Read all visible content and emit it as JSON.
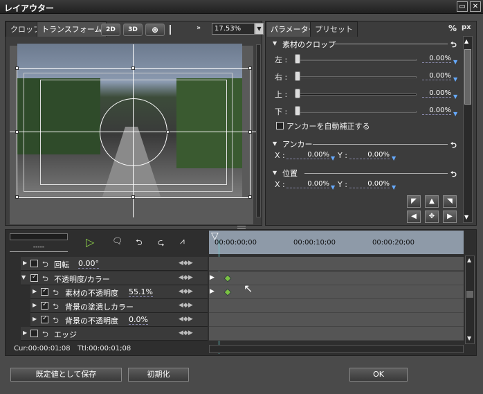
{
  "window": {
    "title": "レイアウター",
    "min_icon": "minimize-icon",
    "close_icon": "close-icon"
  },
  "left_tabs": {
    "crop": "クロップ",
    "transform": "トランスフォーム"
  },
  "toolbar": {
    "btn_2d": "2D",
    "btn_3d": "3D",
    "zoom": "17.53%"
  },
  "right_tabs": {
    "params": "パラメーター",
    "presets": "プリセット",
    "percent": "%",
    "px": "px"
  },
  "crop": {
    "section": "素材のクロップ",
    "left": "左 :",
    "right": "右 :",
    "top": "上 :",
    "bottom": "下 :",
    "left_val": "0.00%",
    "right_val": "0.00%",
    "top_val": "0.00%",
    "bottom_val": "0.00%",
    "auto_correct": "アンカーを自動補正する"
  },
  "anchor": {
    "section": "アンカー",
    "x_label": "X :",
    "y_label": "Y :",
    "x_val": "0.00%",
    "y_val": "0.00%"
  },
  "position": {
    "section": "位置",
    "x_label": "X :",
    "y_label": "Y :",
    "x_val": "0.00%",
    "y_val": "0.00%"
  },
  "timeline": {
    "ticks": [
      "00:00:00;00",
      "00:00:10;00",
      "00:00:20;00"
    ],
    "rotate": {
      "label": "回転",
      "value": "0.00°"
    },
    "opacity_color": {
      "label": "不透明度/カラー"
    },
    "clip_opacity": {
      "label": "素材の不透明度",
      "value": "55.1%"
    },
    "bg_fill": {
      "label": "背景の塗潰しカラー"
    },
    "bg_opacity": {
      "label": "背景の不透明度",
      "value": "0.0%"
    },
    "edge": {
      "label": "エッジ"
    },
    "cur": "Cur:00:00:01;08",
    "ttl": "Ttl:00:00:01;08",
    "dash": "-----"
  },
  "buttons": {
    "save_default": "既定値として保存",
    "init": "初期化",
    "ok": "OK"
  }
}
